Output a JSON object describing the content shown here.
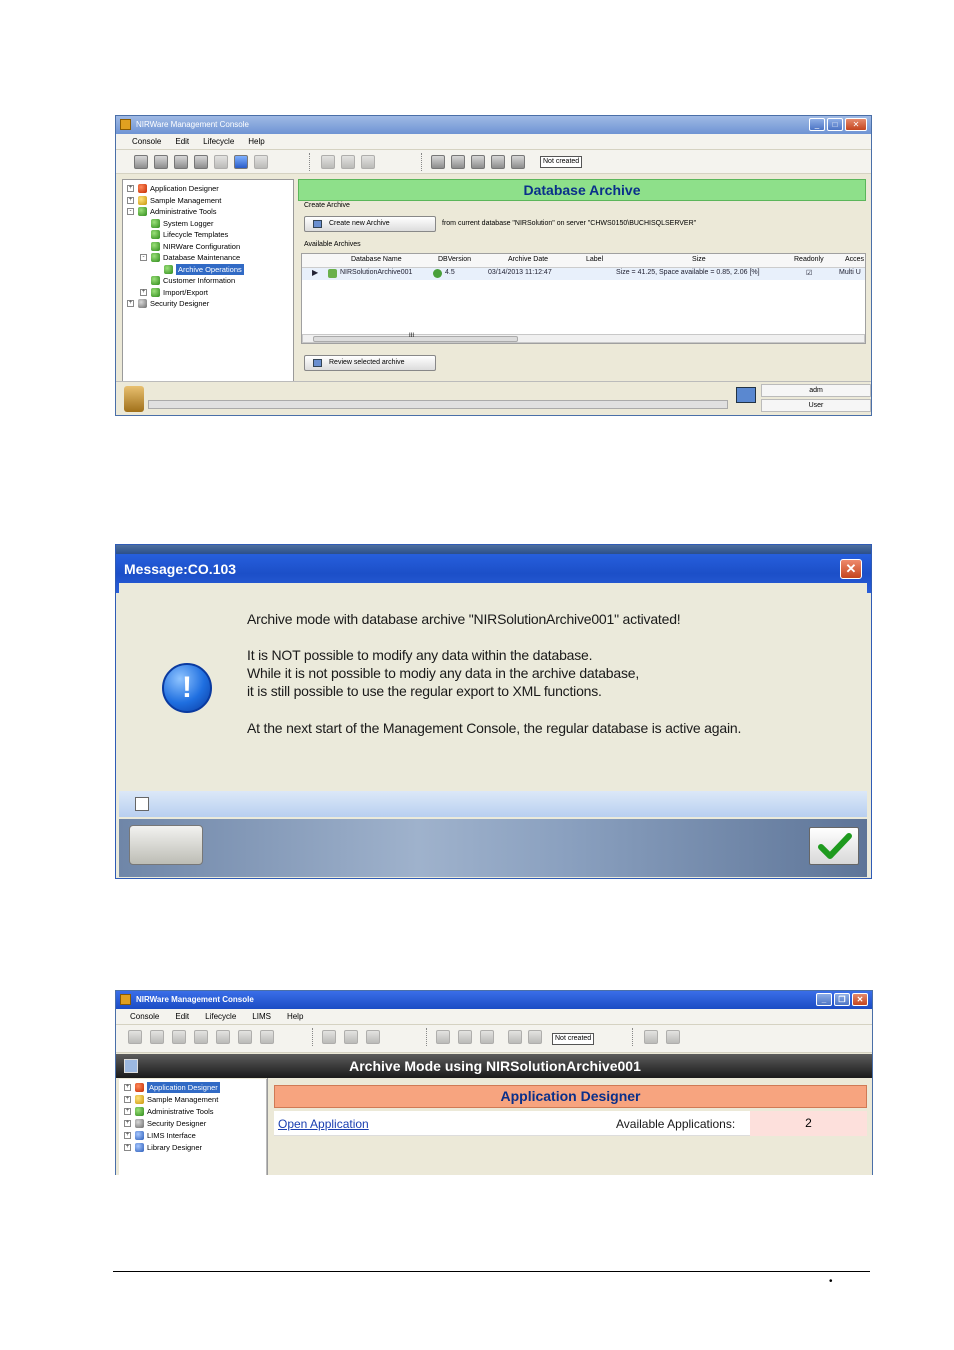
{
  "window1": {
    "title": "NIRWare Management Console",
    "menu": [
      "Console",
      "Edit",
      "Lifecycle",
      "Help"
    ],
    "toolbar_status": "Not created",
    "tree": [
      {
        "label": "Application Designer",
        "indent": 0,
        "expander": "+",
        "icon": "red"
      },
      {
        "label": "Sample Management",
        "indent": 0,
        "expander": "+",
        "icon": "yel"
      },
      {
        "label": "Administrative Tools",
        "indent": 0,
        "expander": "-",
        "icon": "grn"
      },
      {
        "label": "System Logger",
        "indent": 1,
        "expander": "",
        "icon": "grn"
      },
      {
        "label": "Lifecycle Templates",
        "indent": 1,
        "expander": "",
        "icon": "grn"
      },
      {
        "label": "NIRWare Configuration",
        "indent": 1,
        "expander": "",
        "icon": "grn"
      },
      {
        "label": "Database Maintenance",
        "indent": 1,
        "expander": "-",
        "icon": "grn"
      },
      {
        "label": "Archive Operations",
        "indent": 2,
        "expander": "",
        "icon": "grn",
        "selected": true
      },
      {
        "label": "Customer Information",
        "indent": 1,
        "expander": "",
        "icon": "grn"
      },
      {
        "label": "Import/Export",
        "indent": 1,
        "expander": "+",
        "icon": "grn"
      },
      {
        "label": "Security Designer",
        "indent": 0,
        "expander": "+",
        "icon": "gry"
      }
    ],
    "panel_title": "Database Archive",
    "create_section": "Create Archive",
    "create_button": "Create new Archive",
    "create_info": "from current database \"NIRSolution\" on server \"CHWS0150\\BUCHISQLSERVER\"",
    "available_section": "Available Archives",
    "grid_headers": [
      "Database Name",
      "DBVersion",
      "Archive Date",
      "Label",
      "Size",
      "Readonly",
      "Acces"
    ],
    "grid_row": {
      "name": "NIRSolutionArchive001",
      "version": "4.5",
      "date": "03/14/2013 11:12:47",
      "label": "",
      "size": "Size = 41.25, Space available = 0.85, 2.06 [%]",
      "readonly": "☑",
      "access": "Multi U"
    },
    "scroll_mark": "III",
    "review_button": "Review selected archive",
    "user_name": "adm",
    "user_role": "User"
  },
  "dialog": {
    "title": "Message:CO.103",
    "close": "✕",
    "lines": [
      "Archive mode with database archive \"NIRSolutionArchive001\" activated!",
      "It is NOT possible to modify any data within the database.",
      "While it is not possible to modiy any data in the archive database,",
      "it is still possible to use the regular export to XML functions.",
      "At the next start of the Management Console, the regular database is active again."
    ],
    "icon_glyph": "!"
  },
  "window3": {
    "title": "NIRWare Management Console",
    "menu": [
      "Console",
      "Edit",
      "Lifecycle",
      "LIMS",
      "Help"
    ],
    "toolbar_status": "Not created",
    "archive_bar": "Archive Mode using NIRSolutionArchive001",
    "tree": [
      {
        "label": "Application Designer",
        "icon": "red",
        "selected": true
      },
      {
        "label": "Sample Management",
        "icon": "yel"
      },
      {
        "label": "Administrative Tools",
        "icon": "grn"
      },
      {
        "label": "Security Designer",
        "icon": "gry"
      },
      {
        "label": "LIMS Interface",
        "icon": "blu"
      },
      {
        "label": "Library Designer",
        "icon": "blu"
      }
    ],
    "panel_title": "Application Designer",
    "open_link": "Open Application",
    "available_label": "Available Applications:",
    "available_value": "2"
  },
  "footer": {
    "bullet": "•"
  }
}
